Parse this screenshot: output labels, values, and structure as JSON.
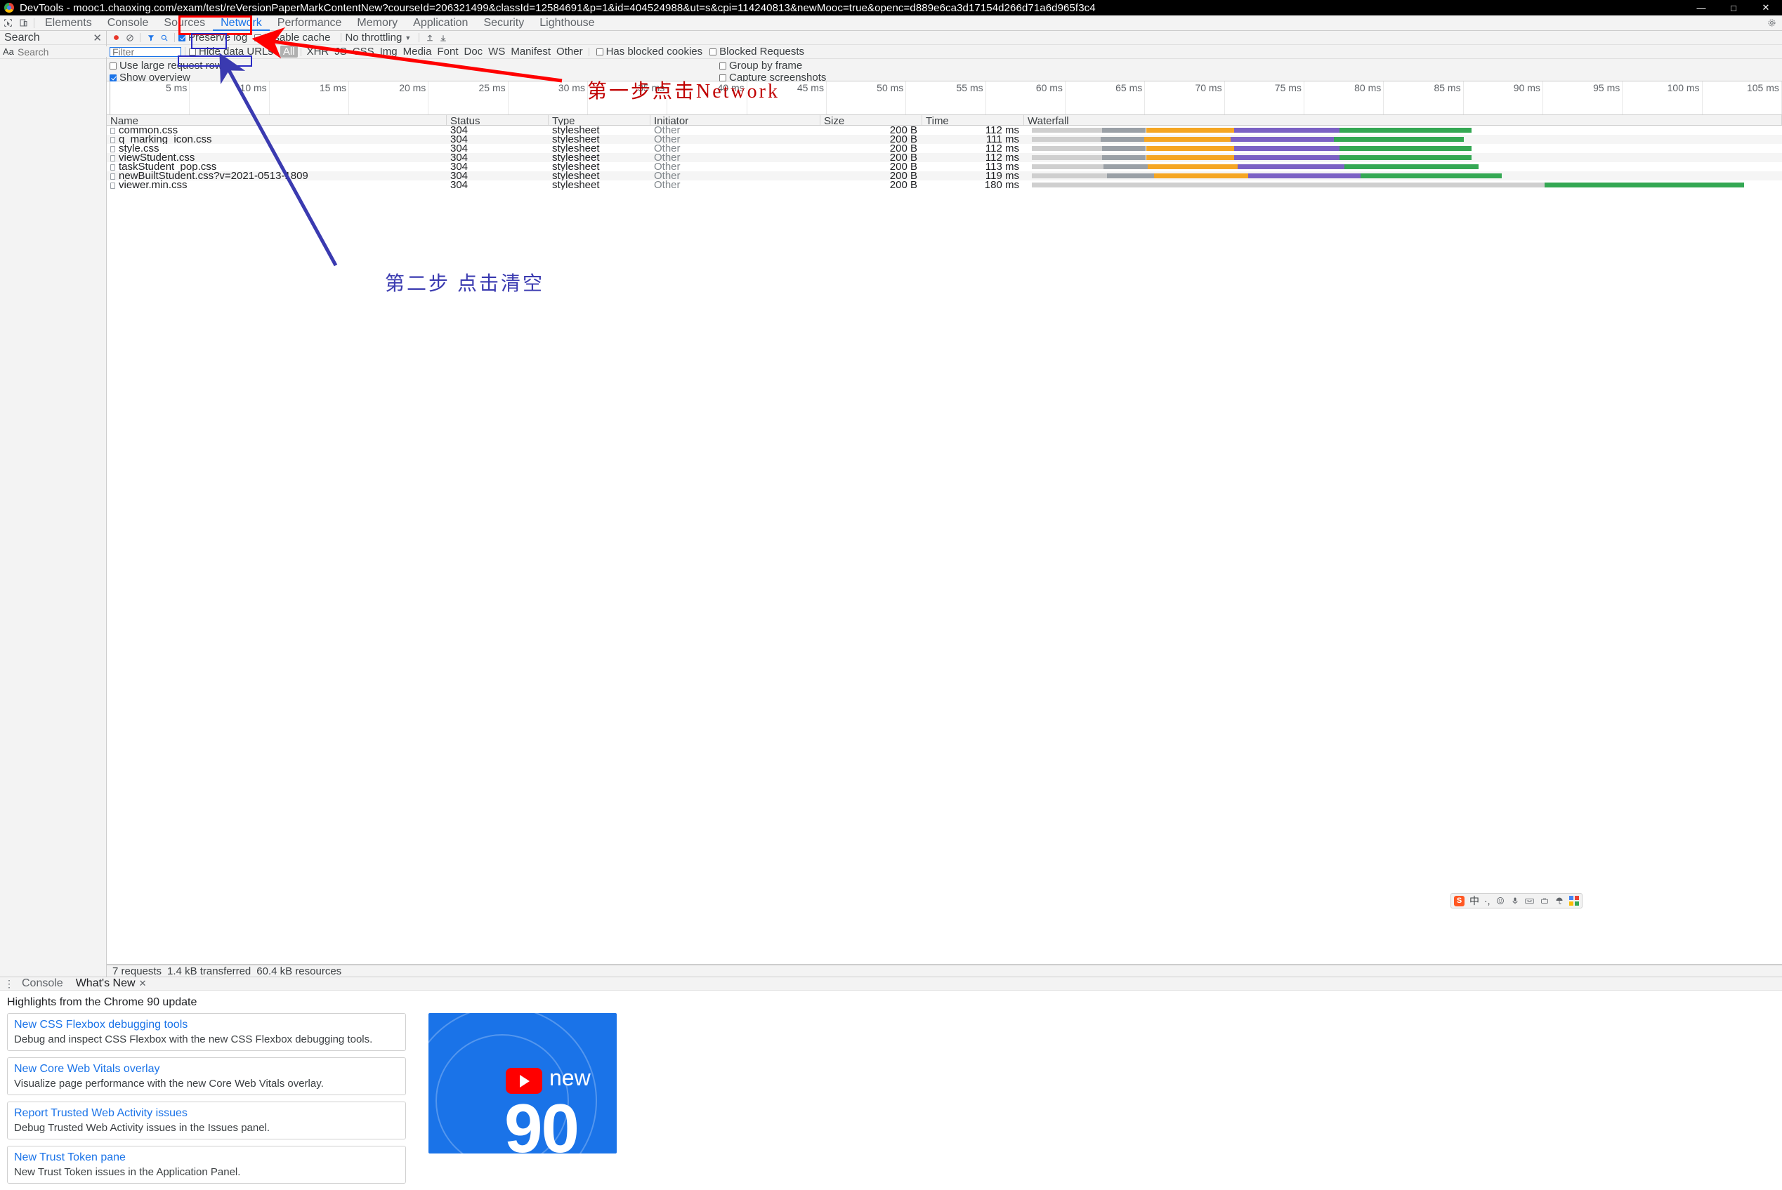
{
  "window": {
    "title": "DevTools - mooc1.chaoxing.com/exam/test/reVersionPaperMarkContentNew?courseId=206321499&classId=12584691&p=1&id=404524988&ut=s&cpi=114240813&newMooc=true&openc=d889e6ca3d17154d266d71a6d965f3c4",
    "minimize": "—",
    "maximize": "□",
    "close": "✕"
  },
  "devtools": {
    "inspect_icon": "inspect-cursor-icon",
    "device_icon": "device-toolbar-icon",
    "tabs": [
      {
        "label": "Elements",
        "active": false
      },
      {
        "label": "Console",
        "active": false
      },
      {
        "label": "Sources",
        "active": false
      },
      {
        "label": "Network",
        "active": true
      },
      {
        "label": "Performance",
        "active": false
      },
      {
        "label": "Memory",
        "active": false
      },
      {
        "label": "Application",
        "active": false
      },
      {
        "label": "Security",
        "active": false
      },
      {
        "label": "Lighthouse",
        "active": false
      }
    ],
    "settings_icon": "gear-icon"
  },
  "search_panel": {
    "title": "Search",
    "close_label": "✕",
    "match_case_label": "Aa",
    "input_placeholder": "Search",
    "refresh_icon": "refresh-icon",
    "clear_icon": "clear-icon"
  },
  "network": {
    "toolbar": {
      "record_icon": "record-button-icon",
      "clear_icon": "clear-network-icon",
      "filter_icon": "filter-funnel-icon",
      "search_icon": "search-icon",
      "preserve_log_label": "Preserve log",
      "preserve_log_checked": true,
      "disable_cache_label": "Disable cache",
      "disable_cache_checked": false,
      "throttling_label": "No throttling",
      "throttling_caret": "▼",
      "import_icon": "import-har-icon",
      "export_icon": "export-har-icon"
    },
    "filterbar": {
      "filter_placeholder": "Filter",
      "filter_value": "",
      "hide_data_urls_label": "Hide data URLs",
      "hide_data_urls_checked": false,
      "types": [
        "All",
        "XHR",
        "JS",
        "CSS",
        "Img",
        "Media",
        "Font",
        "Doc",
        "WS",
        "Manifest",
        "Other"
      ],
      "selected_type": "All",
      "has_blocked_cookies_label": "Has blocked cookies",
      "has_blocked_cookies_checked": false,
      "blocked_requests_label": "Blocked Requests",
      "blocked_requests_checked": false
    },
    "options": {
      "use_large_request_rows_label": "Use large request rows",
      "use_large_request_rows_checked": false,
      "show_overview_label": "Show overview",
      "show_overview_checked": true,
      "group_by_frame_label": "Group by frame",
      "group_by_frame_checked": false,
      "capture_screenshots_label": "Capture screenshots",
      "capture_screenshots_checked": false
    },
    "overview_ticks": [
      "5 ms",
      "10 ms",
      "15 ms",
      "20 ms",
      "25 ms",
      "30 ms",
      "35 ms",
      "40 ms",
      "45 ms",
      "50 ms",
      "55 ms",
      "60 ms",
      "65 ms",
      "70 ms",
      "75 ms",
      "80 ms",
      "85 ms",
      "90 ms",
      "95 ms",
      "100 ms",
      "105 ms"
    ],
    "columns": [
      "Name",
      "Status",
      "Type",
      "Initiator",
      "Size",
      "Time",
      "Waterfall"
    ],
    "rows": [
      {
        "name": "common.css",
        "status": "304",
        "type": "stylesheet",
        "initiator": "Other",
        "size": "200 B",
        "time": "112 ms",
        "wf_start": 1,
        "wf_len": 58
      },
      {
        "name": "q_marking_icon.css",
        "status": "304",
        "type": "stylesheet",
        "initiator": "Other",
        "size": "200 B",
        "time": "111 ms",
        "wf_start": 1,
        "wf_len": 57
      },
      {
        "name": "style.css",
        "status": "304",
        "type": "stylesheet",
        "initiator": "Other",
        "size": "200 B",
        "time": "112 ms",
        "wf_start": 1,
        "wf_len": 58
      },
      {
        "name": "viewStudent.css",
        "status": "304",
        "type": "stylesheet",
        "initiator": "Other",
        "size": "200 B",
        "time": "112 ms",
        "wf_start": 1,
        "wf_len": 58
      },
      {
        "name": "taskStudent_pop.css",
        "status": "304",
        "type": "stylesheet",
        "initiator": "Other",
        "size": "200 B",
        "time": "113 ms",
        "wf_start": 1,
        "wf_len": 59
      },
      {
        "name": "newBuiltStudent.css?v=2021-0513-1809",
        "status": "304",
        "type": "stylesheet",
        "initiator": "Other",
        "size": "200 B",
        "time": "119 ms",
        "wf_start": 1,
        "wf_len": 62
      },
      {
        "name": "viewer.min.css",
        "status": "304",
        "type": "stylesheet",
        "initiator": "Other",
        "size": "200 B",
        "time": "180 ms",
        "wf_start": 1,
        "wf_len": 94
      }
    ],
    "status_bar": {
      "requests": "7 requests",
      "transferred": "1.4 kB transferred",
      "resources": "60.4 kB resources"
    }
  },
  "drawer": {
    "more_icon": "more-vertical-icon",
    "tabs": [
      {
        "label": "Console",
        "active": false,
        "closable": false
      },
      {
        "label": "What's New",
        "active": true,
        "closable": true
      }
    ],
    "close_label": "✕",
    "whats_new": {
      "heading": "Highlights from the Chrome 90 update",
      "cards": [
        {
          "title": "New CSS Flexbox debugging tools",
          "desc": "Debug and inspect CSS Flexbox with the new CSS Flexbox debugging tools."
        },
        {
          "title": "New Core Web Vitals overlay",
          "desc": "Visualize page performance with the new Core Web Vitals overlay."
        },
        {
          "title": "Report Trusted Web Activity issues",
          "desc": "Debug Trusted Web Activity issues in the Issues panel."
        },
        {
          "title": "New Trust Token pane",
          "desc": "New Trust Token issues in the Application Panel."
        }
      ],
      "video": {
        "new_label": "new",
        "version_label": "90"
      }
    }
  },
  "annotations": {
    "step1": "第一步点击Network",
    "step2": "第二步 点击清空"
  },
  "ime": {
    "logo": "S",
    "mode_label": "中",
    "punct_label": "·,",
    "emoji_icon": "emoji-icon",
    "mic_icon": "microphone-icon",
    "keyboard_icon": "keyboard-icon",
    "tools_icon": "toolbox-icon",
    "umbrella_icon": "umbrella-icon",
    "apps_icon": "apps-grid-icon"
  },
  "colors": {
    "accent": "#1a73e8",
    "annotation_red": "#ff0000",
    "annotation_blue": "#2b2bc4",
    "text_red": "#c00000",
    "toolbar_bg": "#f3f3f3"
  }
}
